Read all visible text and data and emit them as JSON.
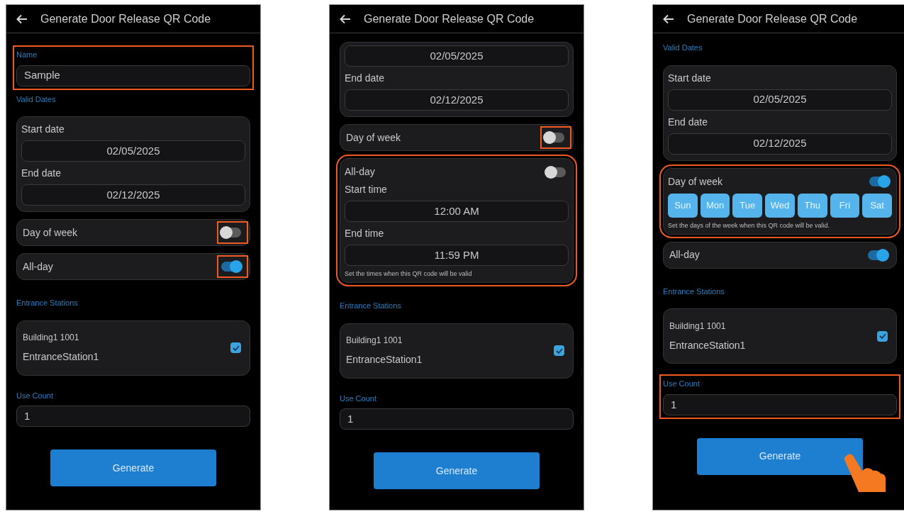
{
  "screens": [
    {
      "title": "Generate Door Release QR Code",
      "items": [
        {
          "kind": "field",
          "label": "Name",
          "value": "Sample",
          "highlighted": true
        },
        {
          "kind": "group",
          "label": "Valid Dates",
          "rows": [
            {
              "label": "Start date",
              "value": "02/05/2025"
            },
            {
              "label": "End date",
              "value": "02/12/2025"
            }
          ]
        },
        {
          "kind": "toggle",
          "label": "Day of week",
          "on": false,
          "highlighted": true
        },
        {
          "kind": "toggle",
          "label": "All-day",
          "on": true,
          "highlighted": true
        },
        {
          "kind": "stations",
          "label": "Entrance Stations",
          "items": [
            {
              "building": "Building1 1001",
              "station": "EntranceStation1",
              "checked": true
            }
          ]
        },
        {
          "kind": "field",
          "label": "Use Count",
          "value": "1"
        },
        {
          "kind": "button",
          "label": "Generate"
        }
      ]
    },
    {
      "title": "Generate Door Release QR Code",
      "items": [
        {
          "kind": "group",
          "rows": [
            {
              "value": "02/05/2025"
            },
            {
              "label": "End date",
              "value": "02/12/2025"
            }
          ]
        },
        {
          "kind": "toggle",
          "label": "Day of week",
          "on": false,
          "highlighted": true
        },
        {
          "kind": "time_card",
          "label": "All-day",
          "on": false,
          "highlighted": true,
          "rows": [
            {
              "label": "Start time",
              "value": "12:00 AM"
            },
            {
              "label": "End time",
              "value": "11:59 PM"
            }
          ],
          "hint": "Set the times when this QR code will be valid"
        },
        {
          "kind": "stations",
          "label": "Entrance Stations",
          "items": [
            {
              "building": "Building1 1001",
              "station": "EntranceStation1",
              "checked": true
            }
          ]
        },
        {
          "kind": "field",
          "label": "Use Count",
          "value": "1"
        },
        {
          "kind": "button",
          "label": "Generate"
        }
      ]
    },
    {
      "title": "Generate Door Release QR Code",
      "tap_hint": true,
      "items": [
        {
          "kind": "group",
          "label": "Valid Dates",
          "rows": [
            {
              "label": "Start date",
              "value": "02/05/2025"
            },
            {
              "label": "End date",
              "value": "02/12/2025"
            }
          ]
        },
        {
          "kind": "days_card",
          "label": "Day of week",
          "on": true,
          "highlighted": true,
          "days": [
            {
              "label": "Sun",
              "selected": true
            },
            {
              "label": "Mon",
              "selected": true
            },
            {
              "label": "Tue",
              "selected": true
            },
            {
              "label": "Wed",
              "selected": true
            },
            {
              "label": "Thu",
              "selected": true
            },
            {
              "label": "Fri",
              "selected": true
            },
            {
              "label": "Sat",
              "selected": true
            }
          ],
          "hint": "Set the days of the week when this QR code will be valid."
        },
        {
          "kind": "toggle",
          "label": "All-day",
          "on": true
        },
        {
          "kind": "stations",
          "label": "Entrance Stations",
          "items": [
            {
              "building": "Building1 1001",
              "station": "EntranceStation1",
              "checked": true
            }
          ]
        },
        {
          "kind": "field",
          "label": "Use Count",
          "value": "1",
          "highlighted": true
        },
        {
          "kind": "button",
          "label": "Generate"
        }
      ]
    }
  ]
}
